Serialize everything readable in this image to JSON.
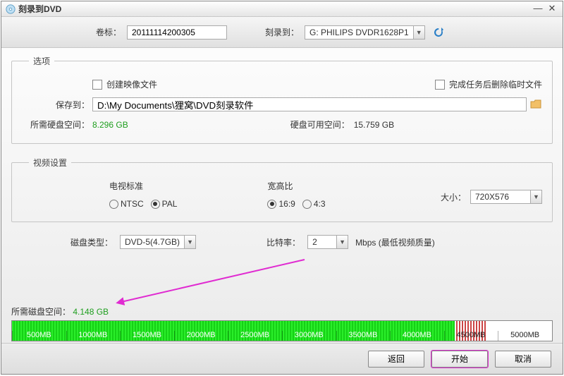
{
  "titlebar": {
    "title": "刻录到DVD"
  },
  "toprow": {
    "volume_label": "卷标：",
    "volume_value": "20111114200305",
    "burn_to_label": "刻录到：",
    "burn_to_value": "G: PHILIPS  DVDR1628P1"
  },
  "options": {
    "legend": "选项",
    "create_image_label": "创建映像文件",
    "delete_temp_label": "完成任务后删除临时文件",
    "save_to_label": "保存到：",
    "save_to_value": "D:\\My Documents\\狸窝\\DVD刻录软件",
    "req_disk_label": "所需硬盘空间：",
    "req_disk_value": "8.296 GB",
    "avail_disk_label": "硬盘可用空间：",
    "avail_disk_value": "15.759 GB"
  },
  "video": {
    "legend": "视频设置",
    "tv_std_label": "电视标准",
    "tv_ntsc": "NTSC",
    "tv_pal": "PAL",
    "aspect_label": "宽高比",
    "aspect_169": "16:9",
    "aspect_43": "4:3",
    "size_label": "大小：",
    "size_value": "720X576"
  },
  "bottom": {
    "disc_type_label": "磁盘类型：",
    "disc_type_value": "DVD-5(4.7GB)",
    "bitrate_label": "比特率：",
    "bitrate_value": "2",
    "bitrate_unit": "Mbps (最低视频质量)"
  },
  "disc_space": {
    "label": "所需磁盘空间：",
    "value": "4.148 GB",
    "ticks": [
      "500MB",
      "1000MB",
      "1500MB",
      "2000MB",
      "2500MB",
      "3000MB",
      "3500MB",
      "4000MB",
      "4500MB",
      "5000MB"
    ]
  },
  "footer": {
    "back": "返回",
    "start": "开始",
    "cancel": "取消"
  }
}
